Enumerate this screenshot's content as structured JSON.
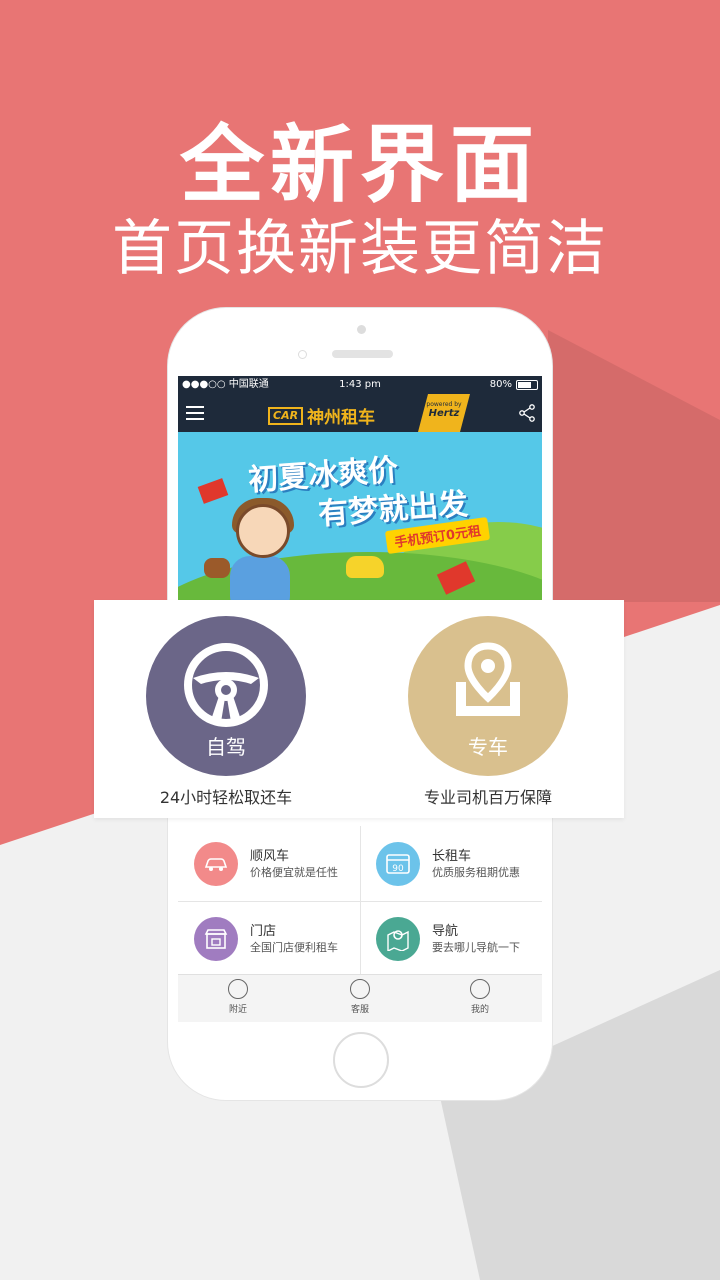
{
  "headline": {
    "title": "全新界面",
    "subtitle": "首页换新装更简洁"
  },
  "status_bar": {
    "carrier": "●●●○○ 中国联通",
    "time": "1:43 pm",
    "battery": "80%",
    "battery_level": 0.8
  },
  "app": {
    "logo_mark": "CAR",
    "logo_text": "神州租车",
    "partner_small": "powered by",
    "partner": "Hertz"
  },
  "banner": {
    "line1": "初夏冰爽价",
    "line2": "有梦就出发",
    "promo": "手机预订0元租"
  },
  "services_primary": [
    {
      "label": "自驾",
      "caption": "24小时轻松取还车",
      "color": "#6b6688",
      "icon": "steering-wheel-icon"
    },
    {
      "label": "专车",
      "caption": "专业司机百万保障",
      "color": "#d9c08e",
      "icon": "location-pin-icon"
    }
  ],
  "services_secondary": [
    {
      "title": "顺风车",
      "subtitle": "价格便宜就是任性",
      "color": "#f28a8a",
      "icon": "car-icon"
    },
    {
      "title": "长租车",
      "subtitle": "优质服务租期优惠",
      "color": "#6cc3ea",
      "icon": "calendar-90-icon",
      "badge": "90"
    },
    {
      "title": "门店",
      "subtitle": "全国门店便利租车",
      "color": "#a07cc0",
      "icon": "store-icon"
    },
    {
      "title": "导航",
      "subtitle": "要去哪儿导航一下",
      "color": "#4aa893",
      "icon": "map-icon"
    }
  ],
  "tabbar": [
    {
      "label": "附近",
      "icon": "nearby-icon"
    },
    {
      "label": "客服",
      "icon": "phone-service-icon"
    },
    {
      "label": "我的",
      "icon": "profile-icon"
    }
  ]
}
